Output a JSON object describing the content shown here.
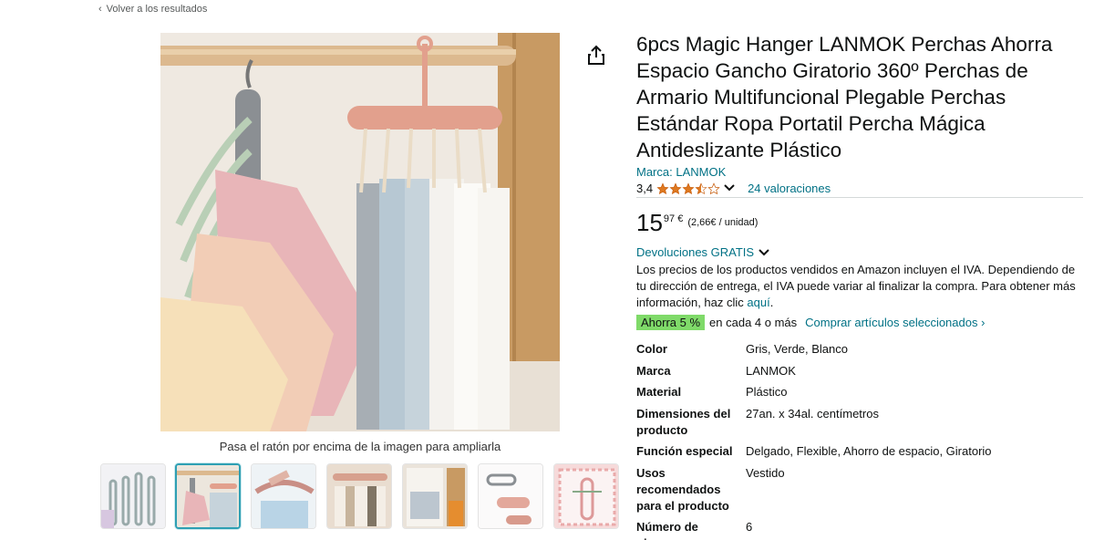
{
  "nav": {
    "back_label": "Volver a los resultados"
  },
  "image": {
    "zoom_hint": "Pasa el ratón por encima de la imagen para ampliarla"
  },
  "product": {
    "title": "6pcs Magic Hanger LANMOK Perchas Ahorra Espacio Gancho Giratorio 360º Perchas de Armario Multifuncional Plegable Perchas Estándar Ropa Portatil Percha Mágica Antideslizante Plástico",
    "brand": "Marca: LANMOK",
    "rating": "3,4",
    "rating_value": 3.4,
    "reviews": "24 valoraciones",
    "price_whole": "15",
    "price_fraction": "97 €",
    "unit_price": "(2,66€ / unidad)",
    "returns": "Devoluciones GRATIS",
    "vat_text": "Los precios de los productos vendidos en Amazon incluyen el IVA. Dependiendo de tu dirección de entrega, el IVA puede variar al finalizar la compra. Para obtener más información, haz clic ",
    "vat_link": "aquí",
    "vat_end": ".",
    "promo_badge": "Ahorra 5 %",
    "promo_text": "en cada 4 o más",
    "promo_link": "Comprar artículos seleccionados ›"
  },
  "specs": [
    {
      "key": "Color",
      "value": "Gris, Verde, Blanco"
    },
    {
      "key": "Marca",
      "value": "LANMOK"
    },
    {
      "key": "Material",
      "value": "Plástico"
    },
    {
      "key": "Dimensiones del producto",
      "value": "27an. x 34al. centímetros"
    },
    {
      "key": "Función especial",
      "value": "Delgado, Flexible, Ahorro de espacio, Giratorio"
    },
    {
      "key": "Usos recomendados para el producto",
      "value": "Vestido"
    },
    {
      "key": "Número de piezas",
      "value": "6"
    }
  ],
  "colors": {
    "link": "#007185",
    "promo_green": "#7fda69",
    "star": "#de7921",
    "thumb_active": "#2e9fb3"
  }
}
